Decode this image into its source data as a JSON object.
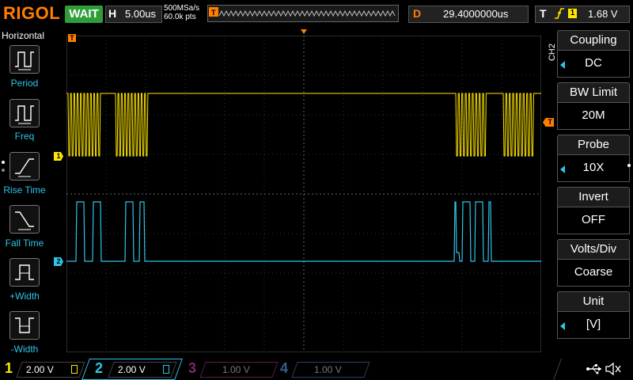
{
  "topbar": {
    "logo": "RIGOL",
    "run_status": "WAIT",
    "horizontal_label": "H",
    "timebase": "5.00us",
    "sample_rate": "500MSa/s",
    "memory_depth": "60.0k pts",
    "delay_label": "D",
    "delay_value": "29.4000000us",
    "trigger_label": "T",
    "trigger_edge": "rising-edge-icon",
    "trigger_source": "1",
    "trigger_level": "1.68 V"
  },
  "left_menu": {
    "title": "Horizontal",
    "items": [
      {
        "label": "Period",
        "icon": "period-icon"
      },
      {
        "label": "Freq",
        "icon": "frequency-icon"
      },
      {
        "label": "Rise Time",
        "icon": "rise-time-icon"
      },
      {
        "label": "Fall Time",
        "icon": "fall-time-icon"
      },
      {
        "label": "+Width",
        "icon": "positive-width-icon"
      },
      {
        "label": "-Width",
        "icon": "negative-width-icon"
      }
    ]
  },
  "right_menu": {
    "channel_tag": "CH2",
    "items": [
      {
        "label": "Coupling",
        "value": "DC"
      },
      {
        "label": "BW Limit",
        "value": "20M"
      },
      {
        "label": "Probe",
        "value": "10X"
      },
      {
        "label": "Invert",
        "value": "OFF"
      },
      {
        "label": "Volts/Div",
        "value": "Coarse"
      },
      {
        "label": "Unit",
        "value": "[V]"
      }
    ]
  },
  "waveform": {
    "ch1_marker": "1",
    "ch2_marker": "2",
    "trigger_marker": "T",
    "ch1_color": "#ffe600",
    "ch2_color": "#2ec5e6"
  },
  "bottom_bar": {
    "channels": [
      {
        "num": "1",
        "scale": "2.00 V",
        "color": "#ffe600",
        "active": true
      },
      {
        "num": "2",
        "scale": "2.00 V",
        "color": "#2ec5e6",
        "active": true
      },
      {
        "num": "3",
        "scale": "1.00 V",
        "color": "#c01e8c",
        "active": false
      },
      {
        "num": "4",
        "scale": "1.00 V",
        "color": "#2a5ccf",
        "active": false
      }
    ],
    "usb_icon": "usb-icon",
    "sound_icon": "sound-muted-icon"
  }
}
